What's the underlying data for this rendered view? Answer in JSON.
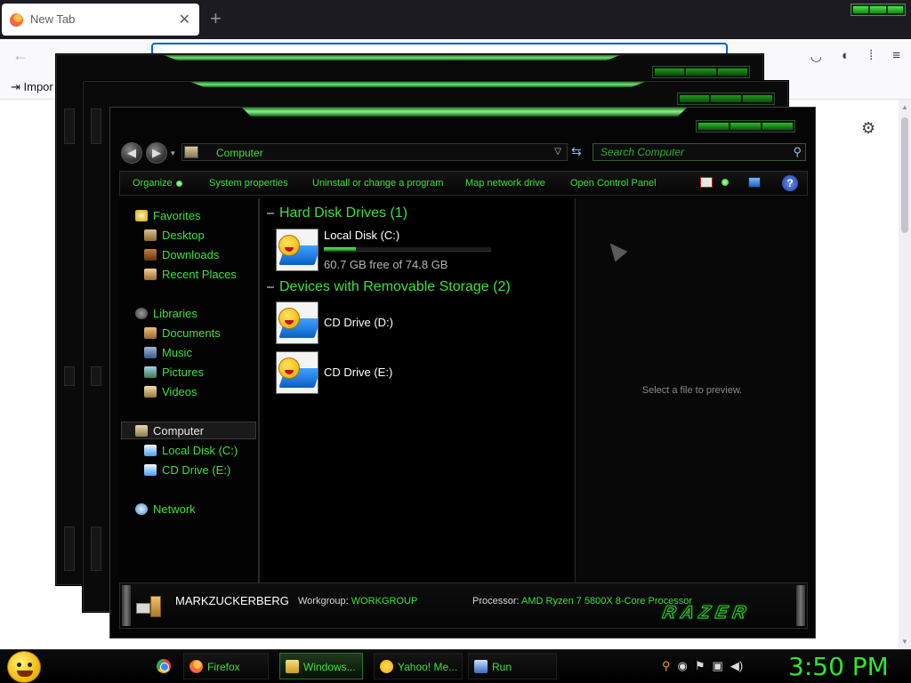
{
  "browser": {
    "tab_title": "New Tab",
    "tab_close": "✕",
    "new_tab": "+",
    "bookmark_import": "Impor"
  },
  "explorer": {
    "address": "Computer",
    "search_placeholder": "Search Computer",
    "toolbar": {
      "organize": "Organize",
      "system_properties": "System properties",
      "uninstall": "Uninstall or change a program",
      "map_drive": "Map network drive",
      "control_panel": "Open Control Panel",
      "help": "?"
    },
    "nav": {
      "favorites": "Favorites",
      "desktop": "Desktop",
      "downloads": "Downloads",
      "recent_places": "Recent Places",
      "libraries": "Libraries",
      "documents": "Documents",
      "music": "Music",
      "pictures": "Pictures",
      "videos": "Videos",
      "computer": "Computer",
      "local_disk": "Local Disk (C:)",
      "cd_drive": "CD Drive (E:)",
      "network": "Network"
    },
    "groups": {
      "hdd": "Hard Disk Drives (1)",
      "removable": "Devices with Removable Storage (2)"
    },
    "drives": {
      "c_name": "Local Disk (C:)",
      "c_free": "60.7 GB free of 74.8 GB",
      "c_used_fraction": 0.19,
      "d_name": "CD Drive (D:)",
      "e_name": "CD Drive (E:)"
    },
    "preview_msg": "Select a file to preview.",
    "details": {
      "computer_name": "MARKZUCKERBERG",
      "workgroup_label": "Workgroup:",
      "workgroup_value": "WORKGROUP",
      "processor_label": "Processor:",
      "processor_value": "AMD Ryzen 7 5800X 8-Core Processor",
      "brand": "RAZER"
    }
  },
  "taskbar": {
    "tasks": {
      "firefox": "Firefox",
      "windows": "Windows...",
      "yahoo": "Yahoo! Me...",
      "run": "Run"
    },
    "clock": "3:50 PM"
  },
  "colors": {
    "accent_green": "#3fe03f",
    "window_bg": "#050505"
  }
}
